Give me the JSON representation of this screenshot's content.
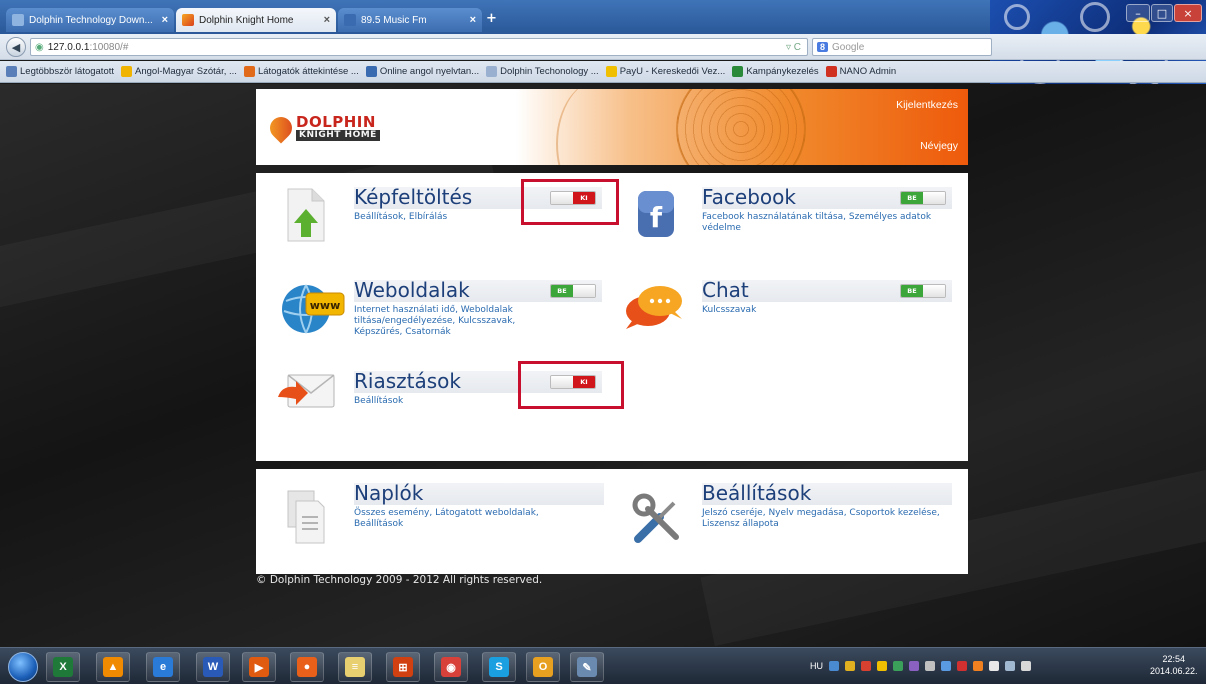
{
  "browser": {
    "tabs": [
      {
        "label": "Dolphin Technology Down...",
        "active": false
      },
      {
        "label": "Dolphin Knight Home",
        "active": true
      },
      {
        "label": "89.5 Music Fm",
        "active": false
      }
    ],
    "new_tab": "+",
    "url_host": "127.0.0.1",
    "url_rest": ":10080/#",
    "search_engine": "8",
    "search_placeholder": "Google",
    "bookmarks": [
      {
        "label": "Legtöbbször látogatott",
        "color": "#5a7fb8"
      },
      {
        "label": "Angol-Magyar Szótár, ...",
        "color": "#f0b400"
      },
      {
        "label": "Látogatók áttekintése ...",
        "color": "#e06a1a"
      },
      {
        "label": "Online angol nyelvtan...",
        "color": "#3a6ab0"
      },
      {
        "label": "Dolphin Techonology ...",
        "color": "#9ab0d0"
      },
      {
        "label": "PayU - Kereskedői Vez...",
        "color": "#f0c000"
      },
      {
        "label": "Kampánykezelés",
        "color": "#2a8a3a"
      },
      {
        "label": "NANO Admin",
        "color": "#d03020"
      }
    ]
  },
  "header": {
    "logo_line1": "DOLPHIN",
    "logo_line2": "KNIGHT HOME",
    "logout": "Kijelentkezés",
    "about": "Névjegy"
  },
  "features": [
    {
      "key": "kepfeltoltes",
      "title": "Képfeltöltés",
      "desc": "Beállítások, Elbírálás",
      "state": "KI"
    },
    {
      "key": "facebook",
      "title": "Facebook",
      "desc": "Facebook használatának tiltása, Személyes adatok védelme",
      "state": "BE"
    },
    {
      "key": "weboldalak",
      "title": "Weboldalak",
      "desc": "Internet használati idő, Weboldalak tiltása/engedélyezése, Kulcsszavak, Képszűrés, Csatornák",
      "state": "BE"
    },
    {
      "key": "chat",
      "title": "Chat",
      "desc": "Kulcsszavak",
      "state": "BE"
    },
    {
      "key": "riasztasok",
      "title": "Riasztások",
      "desc": "Beállítások",
      "state": "KI"
    }
  ],
  "tools": [
    {
      "key": "naplok",
      "title": "Naplók",
      "desc": "Összes esemény, Látogatott weboldalak, Beállítások"
    },
    {
      "key": "beallitasok",
      "title": "Beállítások",
      "desc": "Jelszó cseréje, Nyelv megadása, Csoportok kezelése, Liszensz állapota"
    }
  ],
  "icons": {
    "www_text": "www",
    "facebook_letter": "f"
  },
  "footer": "© Dolphin Technology 2009 - 2012 All rights reserved.",
  "taskbar": {
    "apps": [
      {
        "name": "excel-icon",
        "glyph": "X",
        "color": "#1f7a3a"
      },
      {
        "name": "vlc-icon",
        "glyph": "▲",
        "color": "#f08a00"
      },
      {
        "name": "ie-icon",
        "glyph": "e",
        "color": "#2a7ad8"
      },
      {
        "name": "word-icon",
        "glyph": "W",
        "color": "#2a5ab8"
      },
      {
        "name": "media-icon",
        "glyph": "▶",
        "color": "#e05a10"
      },
      {
        "name": "firefox-icon",
        "glyph": "●",
        "color": "#e8601a"
      },
      {
        "name": "notes-icon",
        "glyph": "≡",
        "color": "#e8d070"
      },
      {
        "name": "windows-icon",
        "glyph": "⊞",
        "color": "#d04010"
      },
      {
        "name": "chrome-icon",
        "glyph": "◉",
        "color": "#d8403a"
      },
      {
        "name": "skype-icon",
        "glyph": "S",
        "color": "#1aa0e0"
      },
      {
        "name": "outlook-icon",
        "glyph": "O",
        "color": "#e8a020"
      },
      {
        "name": "paint-icon",
        "glyph": "✎",
        "color": "#6a8ab0"
      }
    ],
    "lang": "HU",
    "time": "22:54",
    "date": "2014.06.22."
  }
}
